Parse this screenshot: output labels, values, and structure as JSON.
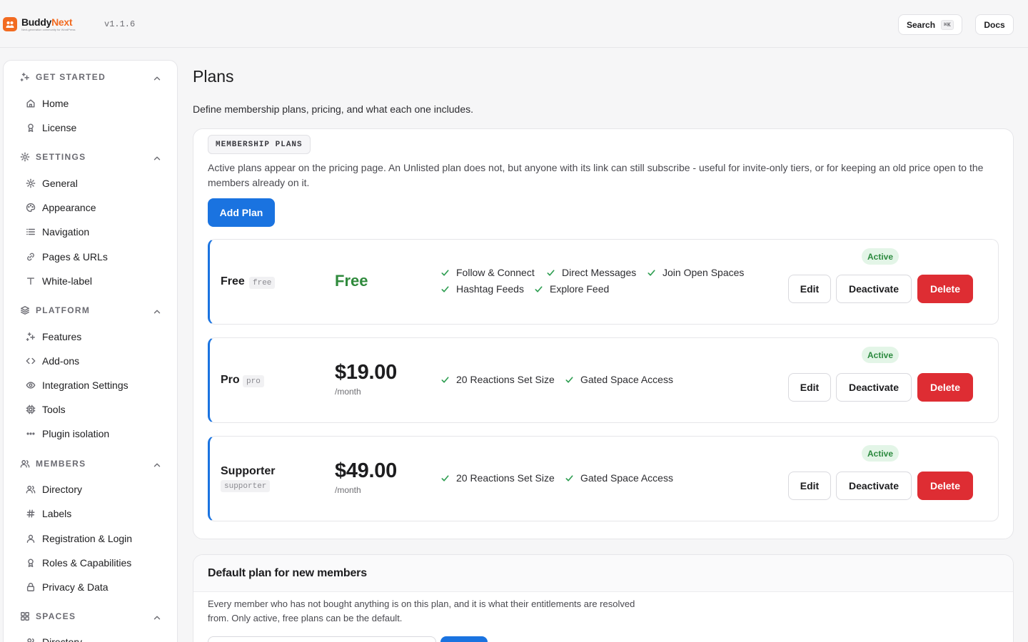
{
  "app": {
    "brand_first": "Buddy",
    "brand_second": "Next",
    "tagline": "Next-generation community for WordPress",
    "version": "v1.1.6",
    "search_label": "Search",
    "search_shortcut": "⌘K",
    "docs_label": "Docs"
  },
  "sidebar": {
    "sections": [
      {
        "title": "GET STARTED",
        "icon": "sparkles-icon",
        "items": [
          {
            "label": "Home",
            "icon": "home-icon"
          },
          {
            "label": "License",
            "icon": "award-icon"
          }
        ]
      },
      {
        "title": "SETTINGS",
        "icon": "gear-icon",
        "items": [
          {
            "label": "General",
            "icon": "gear-icon"
          },
          {
            "label": "Appearance",
            "icon": "palette-icon"
          },
          {
            "label": "Navigation",
            "icon": "list-icon"
          },
          {
            "label": "Pages & URLs",
            "icon": "link-icon"
          },
          {
            "label": "White-label",
            "icon": "type-icon"
          }
        ]
      },
      {
        "title": "PLATFORM",
        "icon": "layers-icon",
        "items": [
          {
            "label": "Features",
            "icon": "sparkles-icon"
          },
          {
            "label": "Add-ons",
            "icon": "code-icon"
          },
          {
            "label": "Integration Settings",
            "icon": "eye-icon"
          },
          {
            "label": "Tools",
            "icon": "cpu-icon"
          },
          {
            "label": "Plugin isolation",
            "icon": "dots-icon"
          }
        ]
      },
      {
        "title": "MEMBERS",
        "icon": "users-icon",
        "items": [
          {
            "label": "Directory",
            "icon": "users-icon"
          },
          {
            "label": "Labels",
            "icon": "hash-icon"
          },
          {
            "label": "Registration & Login",
            "icon": "user-icon"
          },
          {
            "label": "Roles & Capabilities",
            "icon": "award-icon"
          },
          {
            "label": "Privacy & Data",
            "icon": "lock-icon"
          }
        ]
      },
      {
        "title": "SPACES",
        "icon": "grid-icon",
        "items": [
          {
            "label": "Directory",
            "icon": "users-icon"
          }
        ]
      }
    ]
  },
  "page": {
    "title": "Plans",
    "description": "Define membership plans, pricing, and what each one includes."
  },
  "plans_card": {
    "chip": "MEMBERSHIP PLANS",
    "description": "Active plans appear on the pricing page. An Unlisted plan does not, but anyone with its link can still subscribe - useful for invite-only tiers, or for keeping an old price open to the members already on it.",
    "add_label": "Add Plan",
    "plans": [
      {
        "name": "Free",
        "slug": "free",
        "price": "Free",
        "period": "",
        "status": "Active",
        "features": [
          "Follow & Connect",
          "Direct Messages",
          "Join Open Spaces",
          "Hashtag Feeds",
          "Explore Feed"
        ]
      },
      {
        "name": "Pro",
        "slug": "pro",
        "price": "$19.00",
        "period": "/month",
        "status": "Active",
        "features": [
          "20 Reactions Set Size",
          "Gated Space Access"
        ]
      },
      {
        "name": "Supporter",
        "slug": "supporter",
        "price": "$49.00",
        "period": "/month",
        "status": "Active",
        "features": [
          "20 Reactions Set Size",
          "Gated Space Access"
        ]
      }
    ],
    "edit_label": "Edit",
    "deactivate_label": "Deactivate",
    "delete_label": "Delete"
  },
  "default_card": {
    "title": "Default plan for new members",
    "description": "Every member who has not bought anything is on this plan, and it is what their entitlements are resolved from. Only active, free plans can be the default."
  },
  "colors": {
    "accent": "#1a73e0",
    "brand": "#f26b21",
    "price_free": "#2f8a3c",
    "badge_bg": "#e3f5e7",
    "danger": "#de2d33"
  }
}
